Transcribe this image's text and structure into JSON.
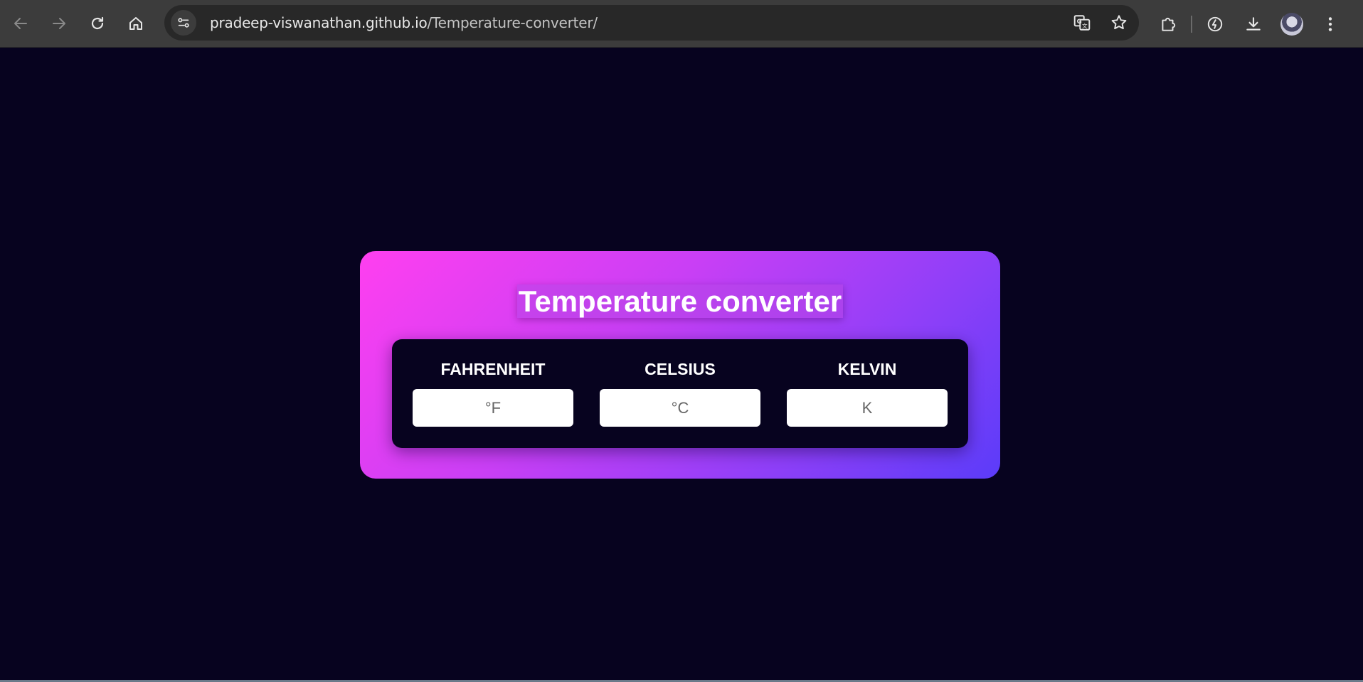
{
  "browser": {
    "url_host": "pradeep-viswanathan.github.io",
    "url_path": "/Temperature-converter/",
    "icons": {
      "back": "arrow-left-icon",
      "forward": "arrow-right-icon",
      "reload": "reload-icon",
      "home": "home-icon",
      "site_info": "tune-icon",
      "translate": "translate-icon",
      "bookmark": "star-icon",
      "extensions": "puzzle-icon",
      "performance": "leaf-icon",
      "downloads": "download-icon",
      "profile": "avatar",
      "menu": "kebab-menu-icon"
    }
  },
  "converter": {
    "title": "Temperature converter",
    "fields": [
      {
        "label": "FAHRENHEIT",
        "placeholder": "°F"
      },
      {
        "label": "CELSIUS",
        "placeholder": "°C"
      },
      {
        "label": "KELVIN",
        "placeholder": "K"
      }
    ],
    "colors": {
      "background": "#07031f",
      "gradient_start": "#ff3ff0",
      "gradient_end": "#5b3cf9",
      "panel": "#07031f"
    }
  }
}
